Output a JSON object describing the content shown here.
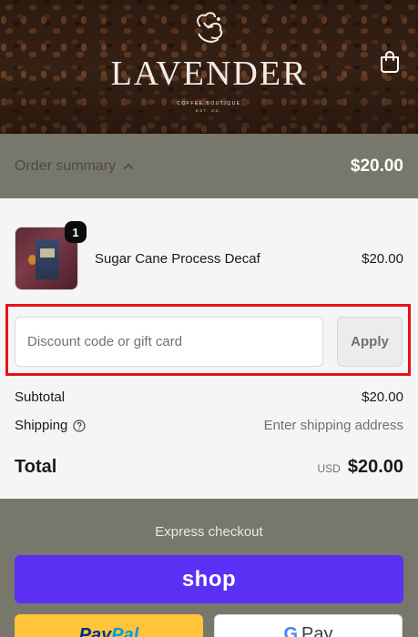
{
  "header": {
    "logo_text": "LAVENDER",
    "logo_sub1": "COFFEE BOUTIQUE",
    "logo_sub2": "EST. CO.",
    "cart_icon": "bag-icon"
  },
  "summary": {
    "toggle_label": "Order summary",
    "toggle_icon": "chevron-up-icon",
    "total": "$20.00"
  },
  "product": {
    "quantity": "1",
    "name": "Sugar Cane Process Decaf",
    "price": "$20.00"
  },
  "discount": {
    "placeholder": "Discount code or gift card",
    "apply_label": "Apply"
  },
  "totals": {
    "subtotal_label": "Subtotal",
    "subtotal_value": "$20.00",
    "shipping_label": "Shipping",
    "shipping_value": "Enter shipping address",
    "total_label": "Total",
    "currency": "USD",
    "total_value": "$20.00"
  },
  "express": {
    "title": "Express checkout",
    "shop_label": "shop",
    "paypal_label_1": "Pay",
    "paypal_label_2": "Pal",
    "gpay_g": "G",
    "gpay_label": "Pay"
  },
  "colors": {
    "summary_bg": "#78776b",
    "shop_purple": "#5a31f4",
    "paypal_yellow": "#ffc439",
    "highlight_red": "#e8101a"
  }
}
